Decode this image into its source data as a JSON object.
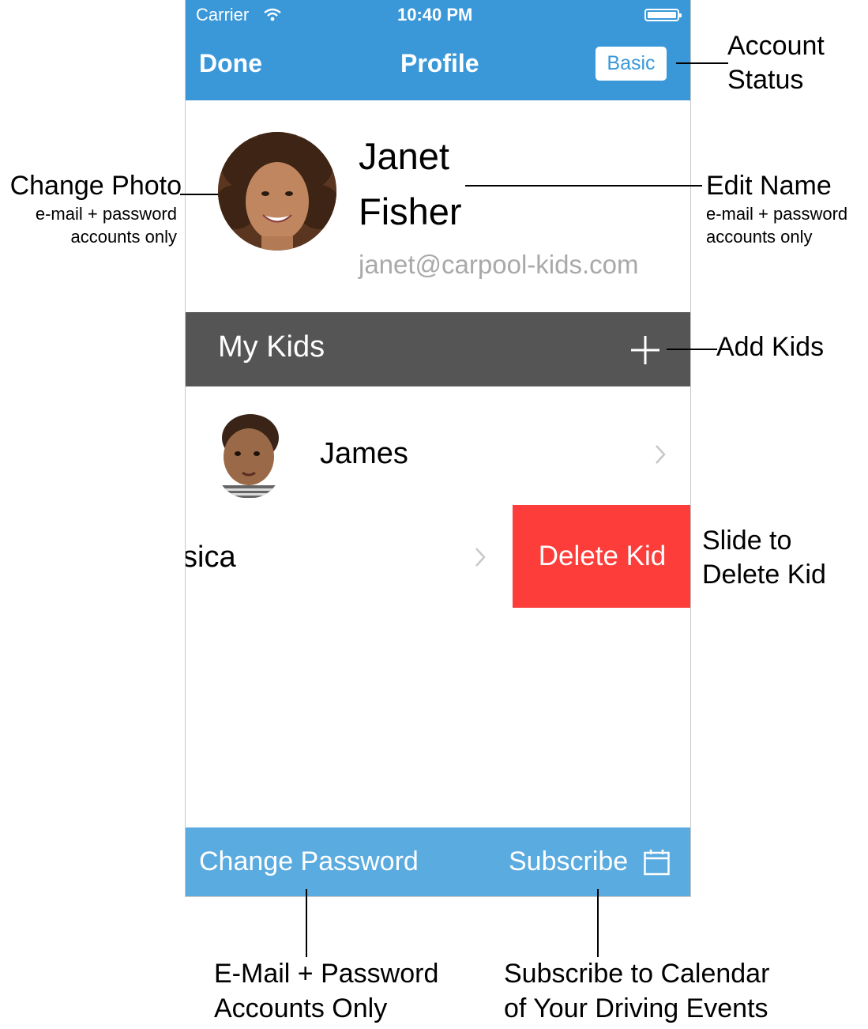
{
  "status_bar": {
    "carrier": "Carrier",
    "time": "10:40 PM"
  },
  "nav": {
    "left_label": "Done",
    "title": "Profile",
    "badge_label": "Basic"
  },
  "profile": {
    "first_name": "Janet",
    "last_name": "Fisher",
    "email": "janet@carpool-kids.com"
  },
  "kids_section": {
    "title": "My Kids",
    "kids": [
      {
        "name": "James"
      },
      {
        "name": "sica"
      }
    ],
    "delete_label": "Delete Kid"
  },
  "bottom_bar": {
    "change_password": "Change Password",
    "subscribe": "Subscribe"
  },
  "annotations": {
    "account_status": [
      "Account",
      "Status"
    ],
    "change_photo": {
      "title": "Change Photo",
      "sub1": "e-mail + password",
      "sub2": "accounts only"
    },
    "edit_name": {
      "title": "Edit Name",
      "sub1": "e-mail + password",
      "sub2": "accounts only"
    },
    "add_kids": "Add Kids",
    "slide_delete": [
      "Slide to",
      "Delete Kid"
    ],
    "email_only": [
      "E-Mail + Password",
      "Accounts Only"
    ],
    "subscribe_cal": [
      "Subscribe to Calendar",
      "of Your Driving Events"
    ]
  },
  "colors": {
    "nav_blue": "#3a98d9",
    "bottom_blue": "#5aabdf",
    "kids_header": "#555555",
    "delete_red": "#fc3d39",
    "email_gray": "#a9a9a9"
  },
  "icons": [
    "wifi-icon",
    "battery-icon",
    "plus-icon",
    "chevron-right-icon",
    "calendar-icon"
  ]
}
